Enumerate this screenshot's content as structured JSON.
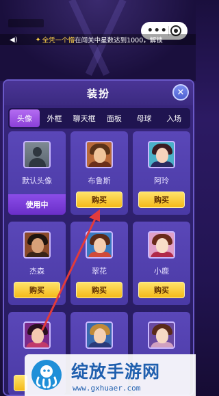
{
  "marquee": {
    "highlight": "全凭一个懵",
    "text": "在闯关中星数达到1000，解锁"
  },
  "panel": {
    "title": "装扮",
    "close_label": "✕",
    "tabs": [
      "头像",
      "外框",
      "聊天框",
      "面板",
      "母球",
      "入场"
    ]
  },
  "items": [
    {
      "name": "默认头像",
      "button": "使用中"
    },
    {
      "name": "布鲁斯",
      "button": "购买"
    },
    {
      "name": "阿玲",
      "button": "购买"
    },
    {
      "name": "杰森",
      "button": "购买"
    },
    {
      "name": "翠花",
      "button": "购买"
    },
    {
      "name": "小鹿",
      "button": "购买"
    }
  ],
  "watermark": {
    "title": "绽放手游网",
    "url": "www.gxhuaer.com"
  },
  "colors": {
    "buy_button": "#f4b919",
    "using_button": "#7a3ad8",
    "active_tab": "#a055e8",
    "arrow": "#e23b3b"
  }
}
